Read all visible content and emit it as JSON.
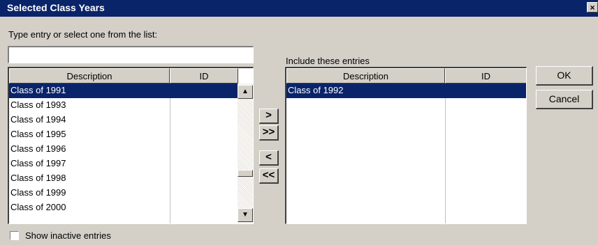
{
  "window": {
    "title": "Selected Class Years",
    "close_glyph": "×"
  },
  "entry": {
    "label": "Type entry or select one from the list:",
    "value": "",
    "placeholder": ""
  },
  "available": {
    "columns": [
      "Description",
      "ID"
    ],
    "rows": [
      {
        "description": "Class of 1991",
        "id": "",
        "selected": true
      },
      {
        "description": "Class of 1993",
        "id": ""
      },
      {
        "description": "Class of 1994",
        "id": ""
      },
      {
        "description": "Class of 1995",
        "id": ""
      },
      {
        "description": "Class of 1996",
        "id": ""
      },
      {
        "description": "Class of 1997",
        "id": ""
      },
      {
        "description": "Class of 1998",
        "id": ""
      },
      {
        "description": "Class of 1999",
        "id": ""
      },
      {
        "description": "Class of 2000",
        "id": ""
      }
    ]
  },
  "included": {
    "label": "Include these entries",
    "columns": [
      "Description",
      "ID"
    ],
    "rows": [
      {
        "description": "Class of 1992",
        "id": "",
        "selected": true
      }
    ]
  },
  "move_buttons": {
    "add": ">",
    "add_all": ">>",
    "remove": "<",
    "remove_all": "<<"
  },
  "scroll_glyphs": {
    "up": "▲",
    "down": "▼"
  },
  "buttons": {
    "ok": "OK",
    "cancel": "Cancel"
  },
  "show_inactive": {
    "label": "Show inactive entries",
    "checked": false
  },
  "colors": {
    "titlebar": "#0a246a",
    "selection": "#0a246a",
    "dialog_bg": "#d4d0c8"
  }
}
